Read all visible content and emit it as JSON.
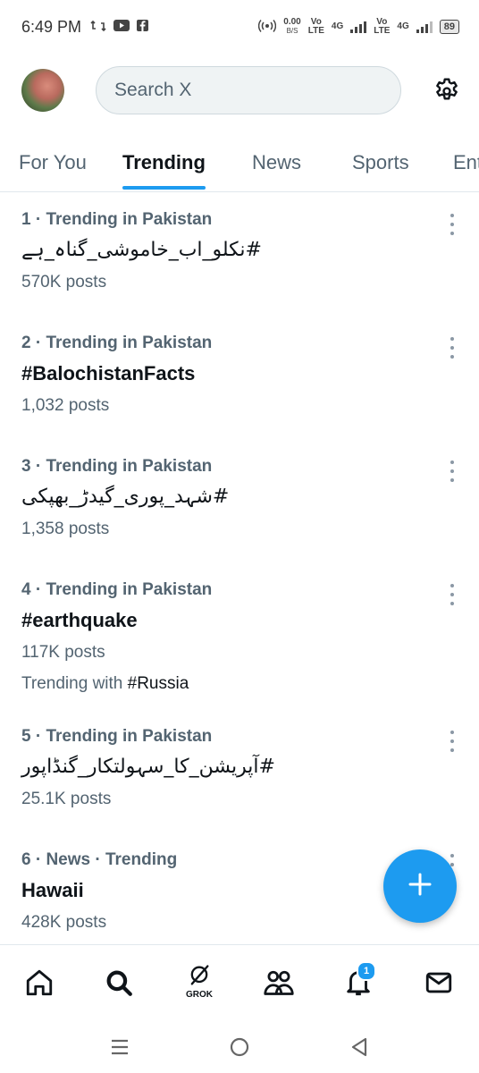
{
  "status_bar": {
    "time": "6:49 PM",
    "net_speed": "0.00",
    "net_unit": "B/S",
    "sim1_top": "Vo",
    "sim1_bottom": "LTE",
    "sim1_type": "4G",
    "sim2_top": "Vo",
    "sim2_bottom": "LTE",
    "sim2_type": "4G",
    "battery": "89"
  },
  "header": {
    "search_placeholder": "Search X"
  },
  "tabs": [
    {
      "label": "For You",
      "active": false
    },
    {
      "label": "Trending",
      "active": true
    },
    {
      "label": "News",
      "active": false
    },
    {
      "label": "Sports",
      "active": false
    },
    {
      "label": "Ent",
      "active": false
    }
  ],
  "trends": [
    {
      "meta": "1 · Trending in Pakistan",
      "name": "#نکلو_اب_خاموشی_گناہ_ہے",
      "posts": "570K posts"
    },
    {
      "meta": "2 · Trending in Pakistan",
      "name": "#BalochistanFacts",
      "posts": "1,032 posts"
    },
    {
      "meta": "3 · Trending in Pakistan",
      "name": "#شہد_پوری_گیدڑ_بھپکی",
      "posts": "1,358 posts"
    },
    {
      "meta": "4 · Trending in Pakistan",
      "name": "#earthquake",
      "posts": "117K posts",
      "with_prefix": "Trending with",
      "with_tag": "#Russia"
    },
    {
      "meta": "5 · Trending in Pakistan",
      "name": "#آپریشن_کا_سہولتکار_گنڈاپور",
      "posts": "25.1K posts"
    },
    {
      "meta": "6 · News · Trending",
      "name": "Hawaii",
      "posts": "428K posts"
    }
  ],
  "bottom_nav": {
    "grok_label": "GROK",
    "notification_count": "1"
  },
  "colors": {
    "accent": "#1d9bf0",
    "text_primary": "#0f1419",
    "text_secondary": "#536471"
  }
}
